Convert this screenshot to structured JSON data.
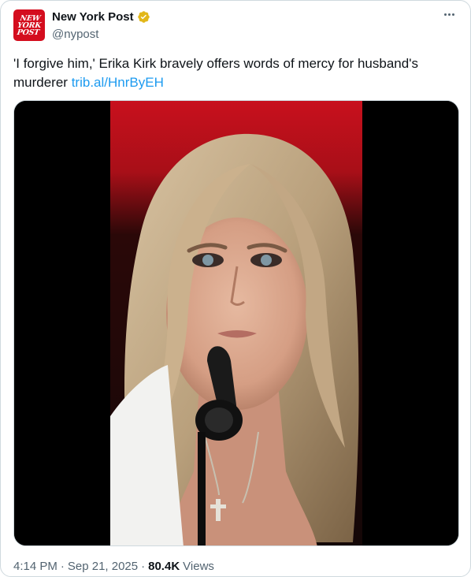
{
  "account": {
    "display_name": "New York Post",
    "handle": "@nypost",
    "avatar_logo_lines": [
      "NEW",
      "YORK",
      "POST"
    ],
    "verified": true,
    "verified_color": "#e2b719",
    "brand_color": "#d40d1e"
  },
  "tweet": {
    "text": "'I forgive him,' Erika Kirk bravely offers words of mercy for husband's murderer",
    "link": "trib.al/HnrByEH",
    "link_color": "#1d9bf0"
  },
  "media": {
    "type": "video-thumbnail"
  },
  "meta": {
    "time": "4:14 PM",
    "separator": "·",
    "date": "Sep 21, 2025",
    "views_count": "80.4K",
    "views_label": "Views"
  },
  "icons": {
    "more": "more-horizontal-icon",
    "verified": "verified-badge-icon"
  }
}
